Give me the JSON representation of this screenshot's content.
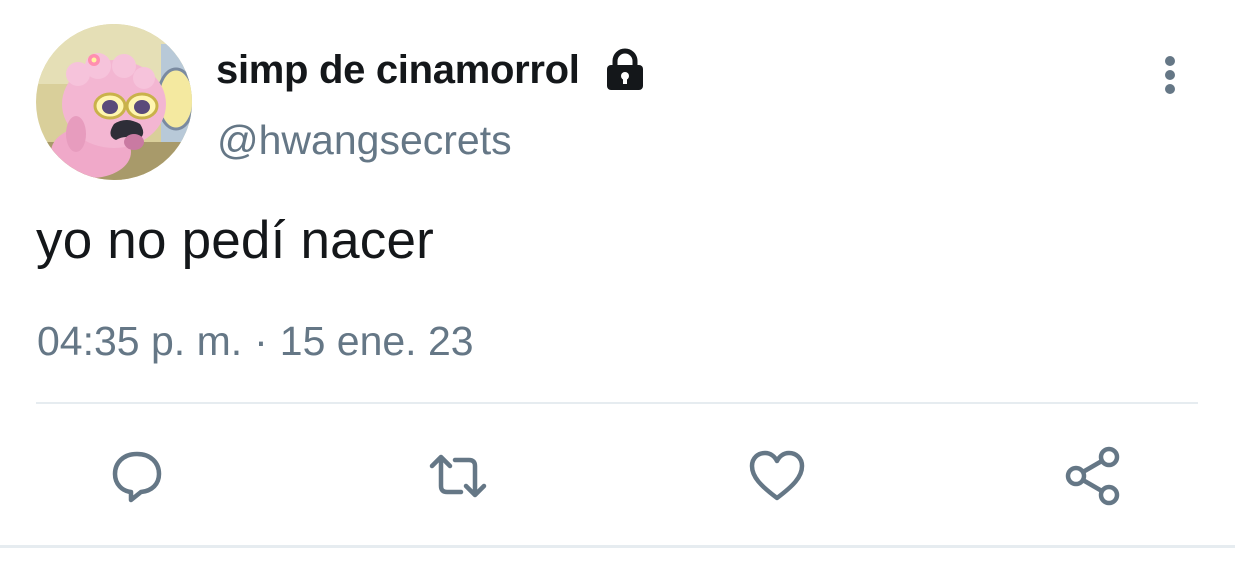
{
  "user": {
    "display_name": "simp de cinamorrol",
    "handle": "@hwangsecrets",
    "protected_icon": "lock-icon",
    "avatar_icon": "avatar-pink-sheep-with-sunglasses"
  },
  "tweet": {
    "text": "yo no pedí nacer",
    "time": "04:35 p. m.",
    "separator": "·",
    "date": "15 ene. 23"
  },
  "actions": [
    {
      "name": "reply",
      "icon": "reply-bubble-icon"
    },
    {
      "name": "retweet",
      "icon": "retweet-arrows-icon"
    },
    {
      "name": "like",
      "icon": "heart-icon"
    },
    {
      "name": "share",
      "icon": "share-nodes-icon"
    }
  ],
  "menu": {
    "icon": "vertical-ellipsis-icon"
  },
  "colors": {
    "text_primary": "#14171a",
    "text_secondary": "#657786",
    "divider": "#e6ecf0",
    "background": "#ffffff"
  }
}
